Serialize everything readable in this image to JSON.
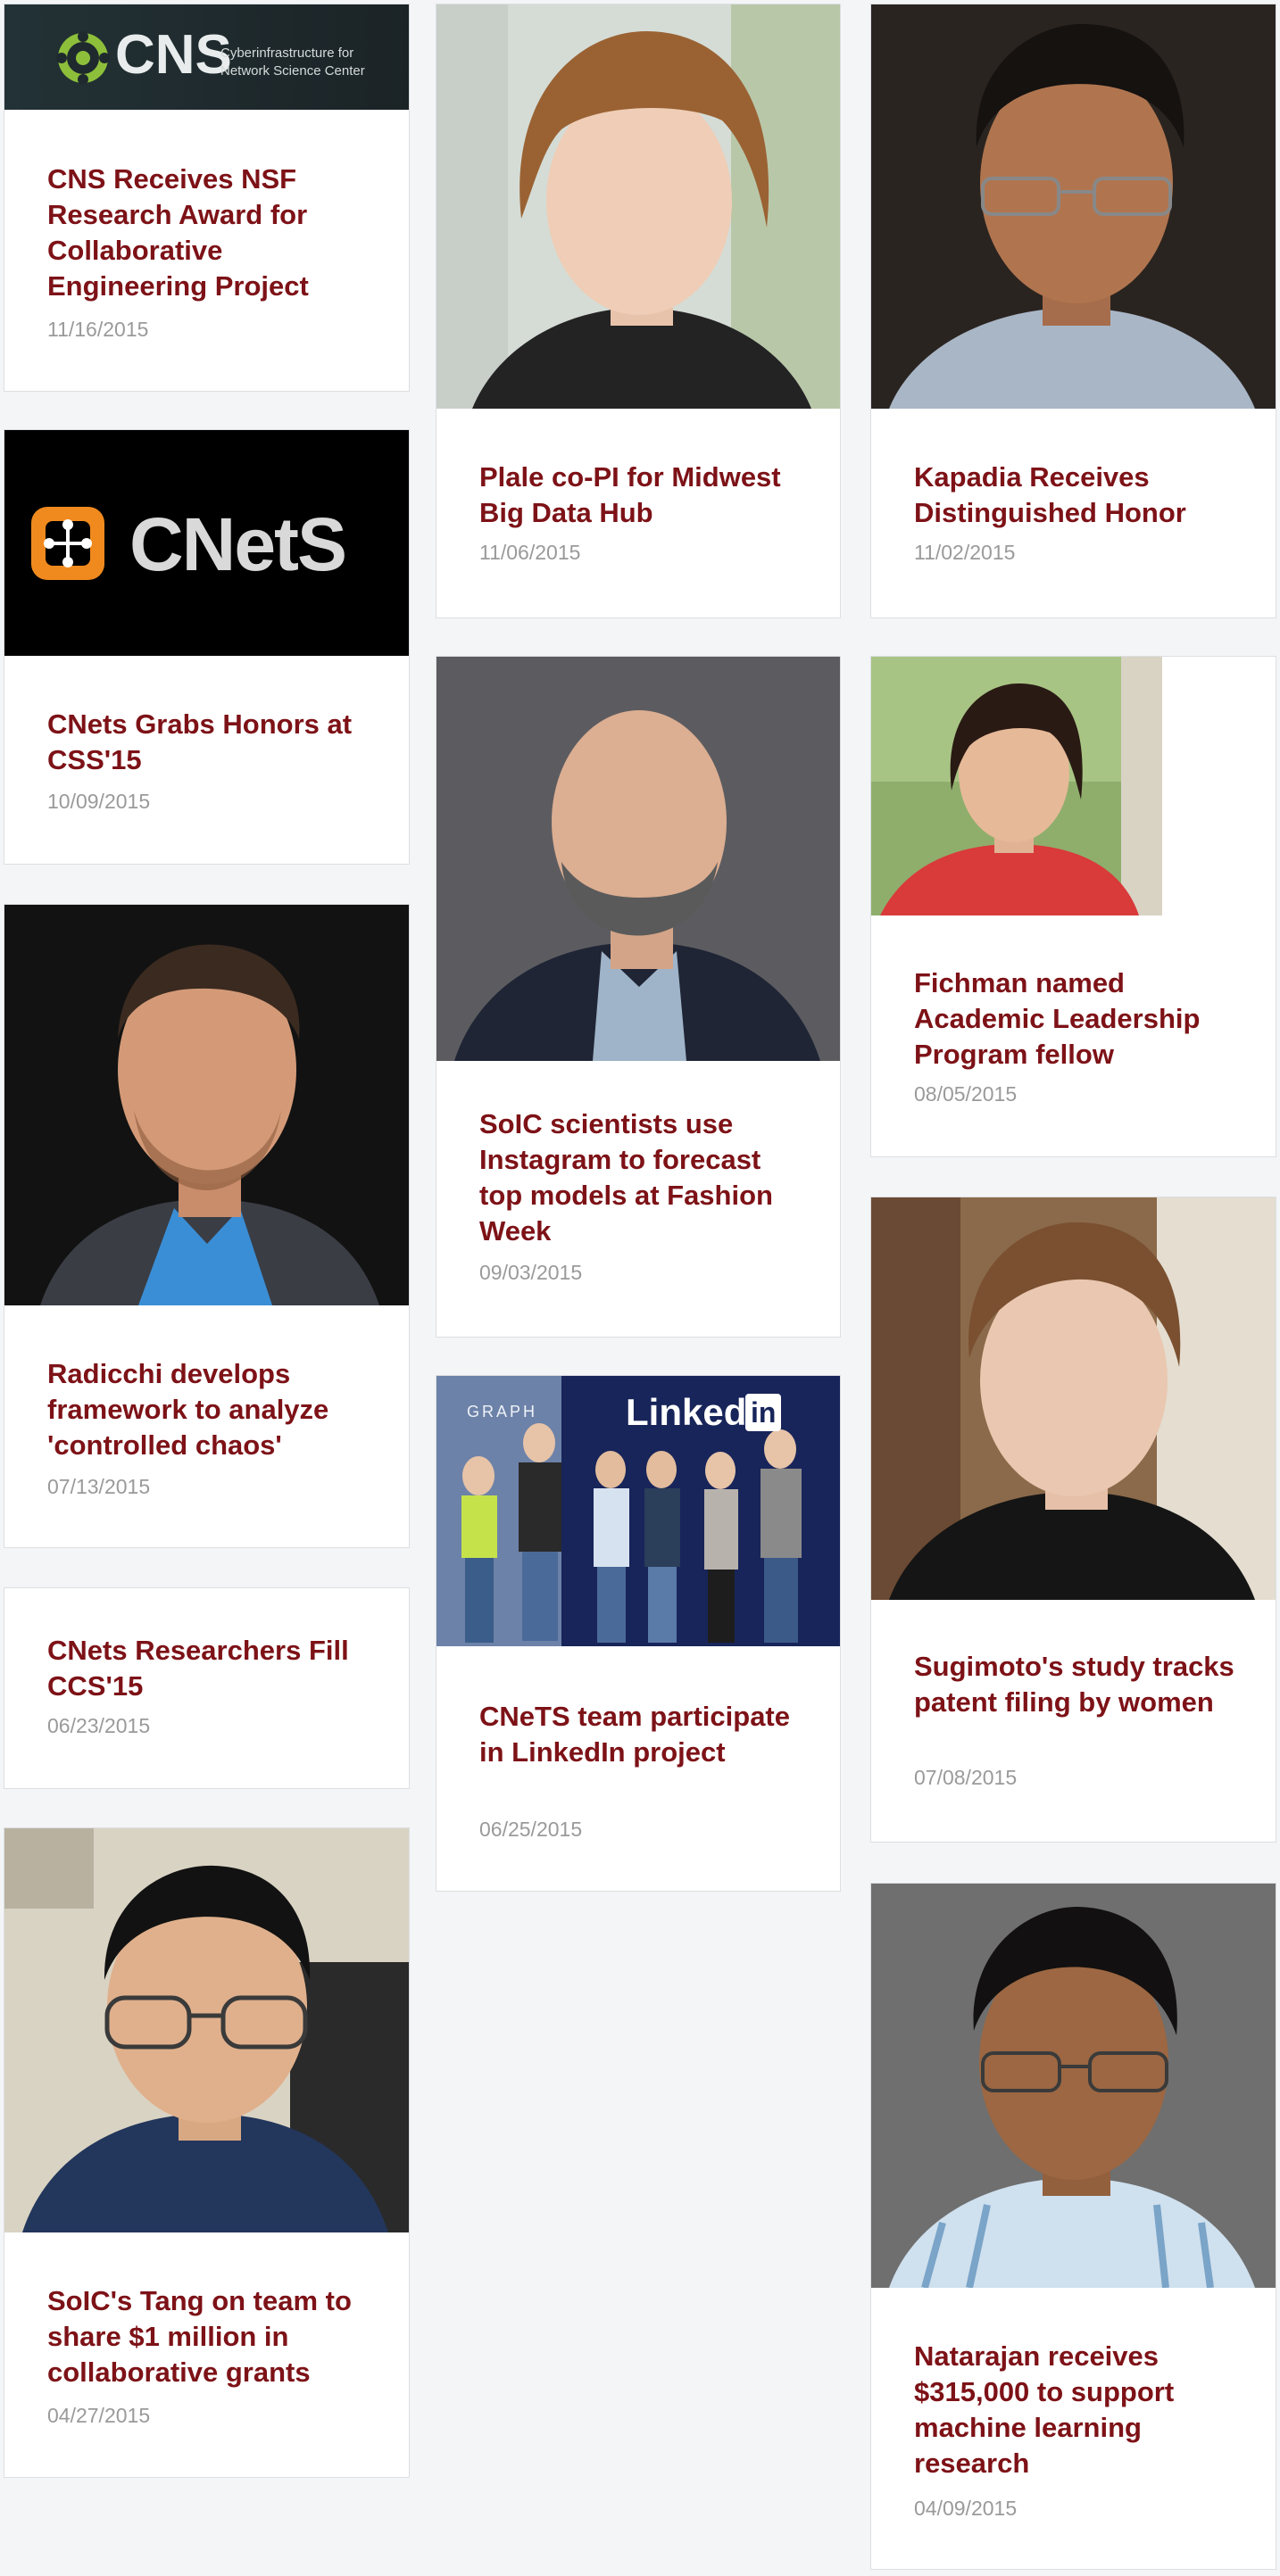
{
  "news_grid": {
    "cards": [
      {
        "title": "CNS Receives NSF Research Award for Collaborative Engineering Project",
        "date": "11/16/2015",
        "image": "CNS logo banner",
        "image_text": [
          "CNS",
          "Cyberinfrastructure for",
          "Network Science Center"
        ]
      },
      {
        "title": "Plale co-PI for Midwest Big Data Hub",
        "date": "11/06/2015",
        "image": "portrait photo"
      },
      {
        "title": "Kapadia Receives Distinguished Honor",
        "date": "11/02/2015",
        "image": "portrait photo"
      },
      {
        "title": "CNets Grabs Honors at CSS'15",
        "date": "10/09/2015",
        "image": "CNetS logo banner",
        "image_text": [
          "CNetS"
        ]
      },
      {
        "title": "SoIC scientists use Instagram to forecast top models at Fashion Week",
        "date": "09/03/2015",
        "image": "portrait photo"
      },
      {
        "title": "Fichman named Academic Leadership Program fellow",
        "date": "08/05/2015",
        "image": "portrait photo"
      },
      {
        "title": "Radicchi develops framework to analyze 'controlled chaos'",
        "date": "07/13/2015",
        "image": "portrait photo"
      },
      {
        "title": "CNets Researchers Fill CCS'15",
        "date": "06/23/2015"
      },
      {
        "title": "CNeTS team participate in LinkedIn project",
        "date": "06/25/2015",
        "image": "group photo",
        "image_text": [
          "Linked",
          "in",
          "GRAPH"
        ]
      },
      {
        "title": "Sugimoto's study tracks patent filing by women",
        "date": "07/08/2015",
        "image": "portrait photo"
      },
      {
        "title": "SoIC's Tang on team to share $1 million in collaborative grants",
        "date": "04/27/2015",
        "image": "portrait photo"
      },
      {
        "title": "Natarajan receives $315,000 to support machine learning research",
        "date": "04/09/2015",
        "image": "portrait photo"
      }
    ]
  },
  "colors": {
    "title": "#7d1217",
    "date": "#9a9a9a",
    "page_background": "#f4f5f7",
    "card_background": "#ffffff"
  }
}
